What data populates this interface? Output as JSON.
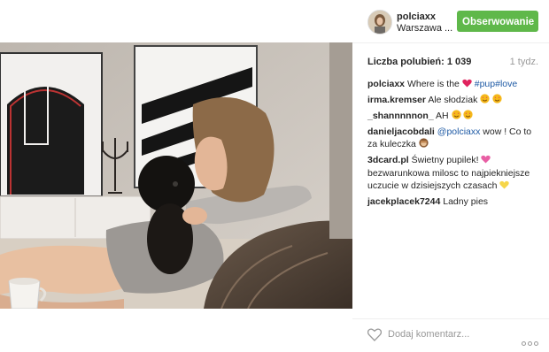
{
  "header": {
    "username": "polciaxx",
    "location": "Warszawa ...",
    "follow_label": "Obserwowanie"
  },
  "likes": {
    "label": "Liczba polubień: 1 039"
  },
  "time": "1 tydz.",
  "caption": {
    "user": "polciaxx",
    "text_before": "Where is the",
    "hashtags": "#pup#love"
  },
  "comments": [
    {
      "user": "irma.kremser",
      "text": "Ale słodziak"
    },
    {
      "user": "_shannnnnon_",
      "text": "AH"
    },
    {
      "user": "danieljacobdali",
      "mention": "@polciaxx",
      "text": "wow ! Co to za kuleczka"
    },
    {
      "user": "3dcard.pl",
      "text": "Świetny pupilek!"
    },
    {
      "user": "",
      "text": "bezwarunkowa milosc to najpiekniejsze uczucie w dzisiejszych czasach"
    },
    {
      "user": "jacekplacek7244",
      "text": "Ladny pies"
    }
  ],
  "footer": {
    "add_comment": "Dodaj komentarz..."
  },
  "icons": {
    "heart": "heart-icon",
    "more": "more-options-icon",
    "emoji_heart_color": "#e0245e",
    "emoji_face_color": "#f5b81b"
  },
  "colors": {
    "follow_button": "#5fb84a",
    "link": "#1e5aa5"
  }
}
